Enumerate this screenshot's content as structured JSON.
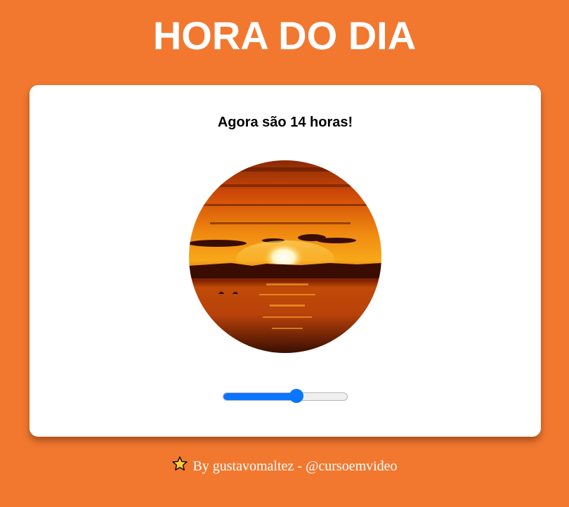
{
  "header": {
    "title": "HORA DO DIA"
  },
  "card": {
    "message": "Agora são 14 horas!",
    "image": {
      "icon": "sunset-photo",
      "shape": "circle"
    },
    "hour_slider": {
      "value": 14,
      "min": 0,
      "max": 23,
      "accent_color": "#0A75FF"
    }
  },
  "footer": {
    "icon": "star-icon",
    "text": "By gustavomaltez - @cursoemvideo"
  },
  "colors": {
    "background": "#F27830",
    "card": "#FFFFFF",
    "title": "#FFFFFF"
  }
}
